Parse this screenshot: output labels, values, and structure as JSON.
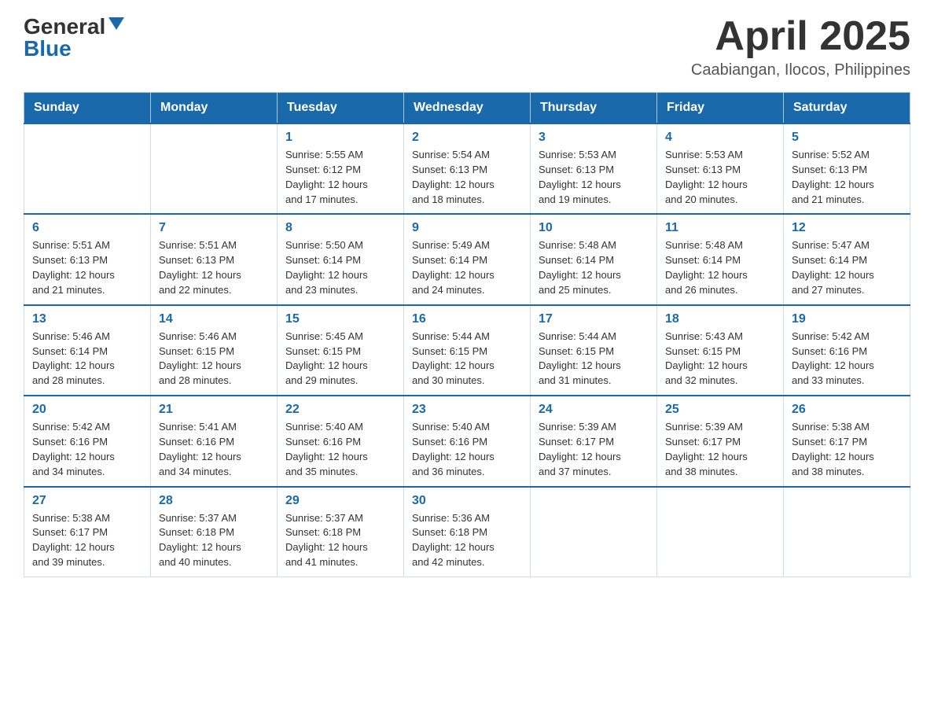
{
  "header": {
    "logo": {
      "general": "General",
      "blue": "Blue"
    },
    "title": "April 2025",
    "location": "Caabiangan, Ilocos, Philippines"
  },
  "calendar": {
    "weekdays": [
      "Sunday",
      "Monday",
      "Tuesday",
      "Wednesday",
      "Thursday",
      "Friday",
      "Saturday"
    ],
    "weeks": [
      [
        {
          "day": "",
          "info": ""
        },
        {
          "day": "",
          "info": ""
        },
        {
          "day": "1",
          "info": "Sunrise: 5:55 AM\nSunset: 6:12 PM\nDaylight: 12 hours\nand 17 minutes."
        },
        {
          "day": "2",
          "info": "Sunrise: 5:54 AM\nSunset: 6:13 PM\nDaylight: 12 hours\nand 18 minutes."
        },
        {
          "day": "3",
          "info": "Sunrise: 5:53 AM\nSunset: 6:13 PM\nDaylight: 12 hours\nand 19 minutes."
        },
        {
          "day": "4",
          "info": "Sunrise: 5:53 AM\nSunset: 6:13 PM\nDaylight: 12 hours\nand 20 minutes."
        },
        {
          "day": "5",
          "info": "Sunrise: 5:52 AM\nSunset: 6:13 PM\nDaylight: 12 hours\nand 21 minutes."
        }
      ],
      [
        {
          "day": "6",
          "info": "Sunrise: 5:51 AM\nSunset: 6:13 PM\nDaylight: 12 hours\nand 21 minutes."
        },
        {
          "day": "7",
          "info": "Sunrise: 5:51 AM\nSunset: 6:13 PM\nDaylight: 12 hours\nand 22 minutes."
        },
        {
          "day": "8",
          "info": "Sunrise: 5:50 AM\nSunset: 6:14 PM\nDaylight: 12 hours\nand 23 minutes."
        },
        {
          "day": "9",
          "info": "Sunrise: 5:49 AM\nSunset: 6:14 PM\nDaylight: 12 hours\nand 24 minutes."
        },
        {
          "day": "10",
          "info": "Sunrise: 5:48 AM\nSunset: 6:14 PM\nDaylight: 12 hours\nand 25 minutes."
        },
        {
          "day": "11",
          "info": "Sunrise: 5:48 AM\nSunset: 6:14 PM\nDaylight: 12 hours\nand 26 minutes."
        },
        {
          "day": "12",
          "info": "Sunrise: 5:47 AM\nSunset: 6:14 PM\nDaylight: 12 hours\nand 27 minutes."
        }
      ],
      [
        {
          "day": "13",
          "info": "Sunrise: 5:46 AM\nSunset: 6:14 PM\nDaylight: 12 hours\nand 28 minutes."
        },
        {
          "day": "14",
          "info": "Sunrise: 5:46 AM\nSunset: 6:15 PM\nDaylight: 12 hours\nand 28 minutes."
        },
        {
          "day": "15",
          "info": "Sunrise: 5:45 AM\nSunset: 6:15 PM\nDaylight: 12 hours\nand 29 minutes."
        },
        {
          "day": "16",
          "info": "Sunrise: 5:44 AM\nSunset: 6:15 PM\nDaylight: 12 hours\nand 30 minutes."
        },
        {
          "day": "17",
          "info": "Sunrise: 5:44 AM\nSunset: 6:15 PM\nDaylight: 12 hours\nand 31 minutes."
        },
        {
          "day": "18",
          "info": "Sunrise: 5:43 AM\nSunset: 6:15 PM\nDaylight: 12 hours\nand 32 minutes."
        },
        {
          "day": "19",
          "info": "Sunrise: 5:42 AM\nSunset: 6:16 PM\nDaylight: 12 hours\nand 33 minutes."
        }
      ],
      [
        {
          "day": "20",
          "info": "Sunrise: 5:42 AM\nSunset: 6:16 PM\nDaylight: 12 hours\nand 34 minutes."
        },
        {
          "day": "21",
          "info": "Sunrise: 5:41 AM\nSunset: 6:16 PM\nDaylight: 12 hours\nand 34 minutes."
        },
        {
          "day": "22",
          "info": "Sunrise: 5:40 AM\nSunset: 6:16 PM\nDaylight: 12 hours\nand 35 minutes."
        },
        {
          "day": "23",
          "info": "Sunrise: 5:40 AM\nSunset: 6:16 PM\nDaylight: 12 hours\nand 36 minutes."
        },
        {
          "day": "24",
          "info": "Sunrise: 5:39 AM\nSunset: 6:17 PM\nDaylight: 12 hours\nand 37 minutes."
        },
        {
          "day": "25",
          "info": "Sunrise: 5:39 AM\nSunset: 6:17 PM\nDaylight: 12 hours\nand 38 minutes."
        },
        {
          "day": "26",
          "info": "Sunrise: 5:38 AM\nSunset: 6:17 PM\nDaylight: 12 hours\nand 38 minutes."
        }
      ],
      [
        {
          "day": "27",
          "info": "Sunrise: 5:38 AM\nSunset: 6:17 PM\nDaylight: 12 hours\nand 39 minutes."
        },
        {
          "day": "28",
          "info": "Sunrise: 5:37 AM\nSunset: 6:18 PM\nDaylight: 12 hours\nand 40 minutes."
        },
        {
          "day": "29",
          "info": "Sunrise: 5:37 AM\nSunset: 6:18 PM\nDaylight: 12 hours\nand 41 minutes."
        },
        {
          "day": "30",
          "info": "Sunrise: 5:36 AM\nSunset: 6:18 PM\nDaylight: 12 hours\nand 42 minutes."
        },
        {
          "day": "",
          "info": ""
        },
        {
          "day": "",
          "info": ""
        },
        {
          "day": "",
          "info": ""
        }
      ]
    ]
  }
}
